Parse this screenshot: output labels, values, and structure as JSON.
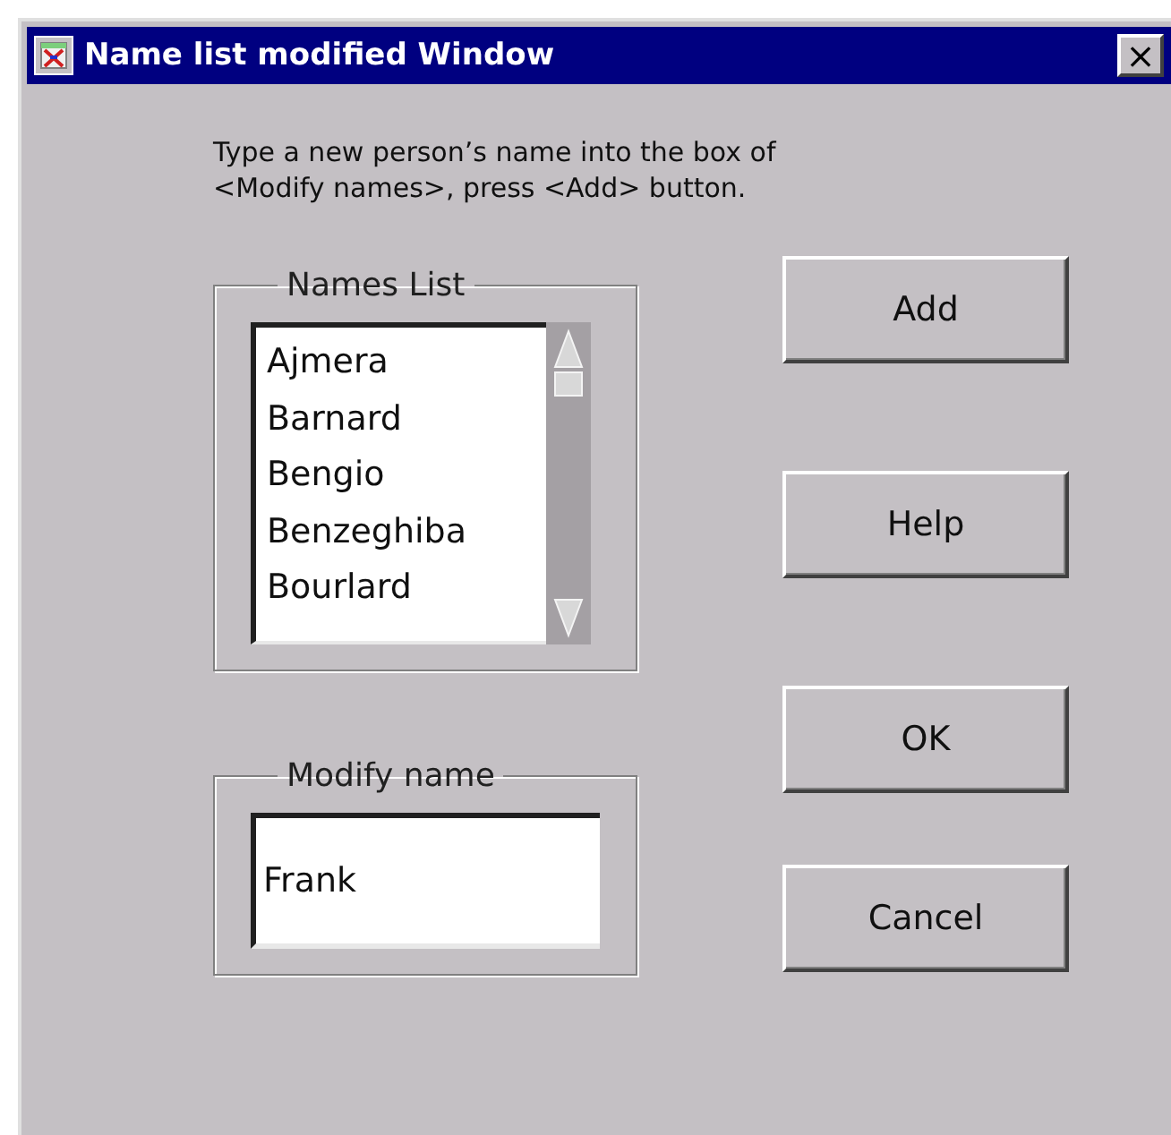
{
  "window": {
    "title": "Name list modified Window",
    "close": "×"
  },
  "instructions": [
    "Type a new person’s name into the box of",
    "<Modify names>, press <Add> button."
  ],
  "names_list": {
    "label": "Names List",
    "items": [
      "Ajmera",
      "Barnard",
      "Bengio",
      "Benzeghiba",
      "Bourlard"
    ]
  },
  "modify_name": {
    "label": "Modify name",
    "value": "Frank"
  },
  "buttons": [
    {
      "label": "Add"
    },
    {
      "label": "Help"
    },
    {
      "label": "OK"
    },
    {
      "label": "Cancel"
    }
  ]
}
